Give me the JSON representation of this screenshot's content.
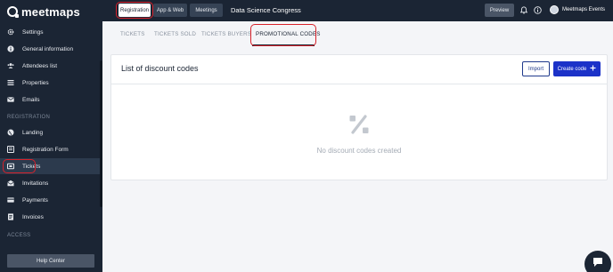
{
  "app": {
    "name": "meetmaps"
  },
  "sidebar": {
    "items": [
      {
        "label": "Settings",
        "icon": "gear-icon"
      },
      {
        "label": "General information",
        "icon": "info-icon"
      },
      {
        "label": "Attendees list",
        "icon": "users-icon"
      },
      {
        "label": "Properties",
        "icon": "list-icon"
      },
      {
        "label": "Emails",
        "icon": "mail-icon"
      }
    ],
    "section_registration": "REGISTRATION",
    "registration_items": [
      {
        "label": "Landing",
        "icon": "globe-icon"
      },
      {
        "label": "Registration Form",
        "icon": "form-icon"
      },
      {
        "label": "Tickets",
        "icon": "ticket-icon",
        "active": true
      },
      {
        "label": "Invitations",
        "icon": "invitation-icon"
      },
      {
        "label": "Payments",
        "icon": "card-icon"
      },
      {
        "label": "Invoices",
        "icon": "invoice-icon"
      }
    ],
    "section_access": "ACCESS",
    "help": "Help Center"
  },
  "topbar": {
    "tabs": [
      "Registration",
      "App & Web",
      "Meetings"
    ],
    "event_title": "Data Science Congress",
    "preview": "Preview",
    "user": "Meetmaps Events"
  },
  "subtabs": [
    "TICKETS",
    "TICKETS SOLD",
    "TICKETS BUYERS",
    "PROMOTIONAL CODES"
  ],
  "card": {
    "title": "List of discount codes",
    "import": "Import",
    "create": "Create code",
    "empty_text": "No discount codes created"
  },
  "colors": {
    "sidebar_bg": "#1b2534",
    "primary": "#1c32c8",
    "highlight": "#d8222b"
  }
}
